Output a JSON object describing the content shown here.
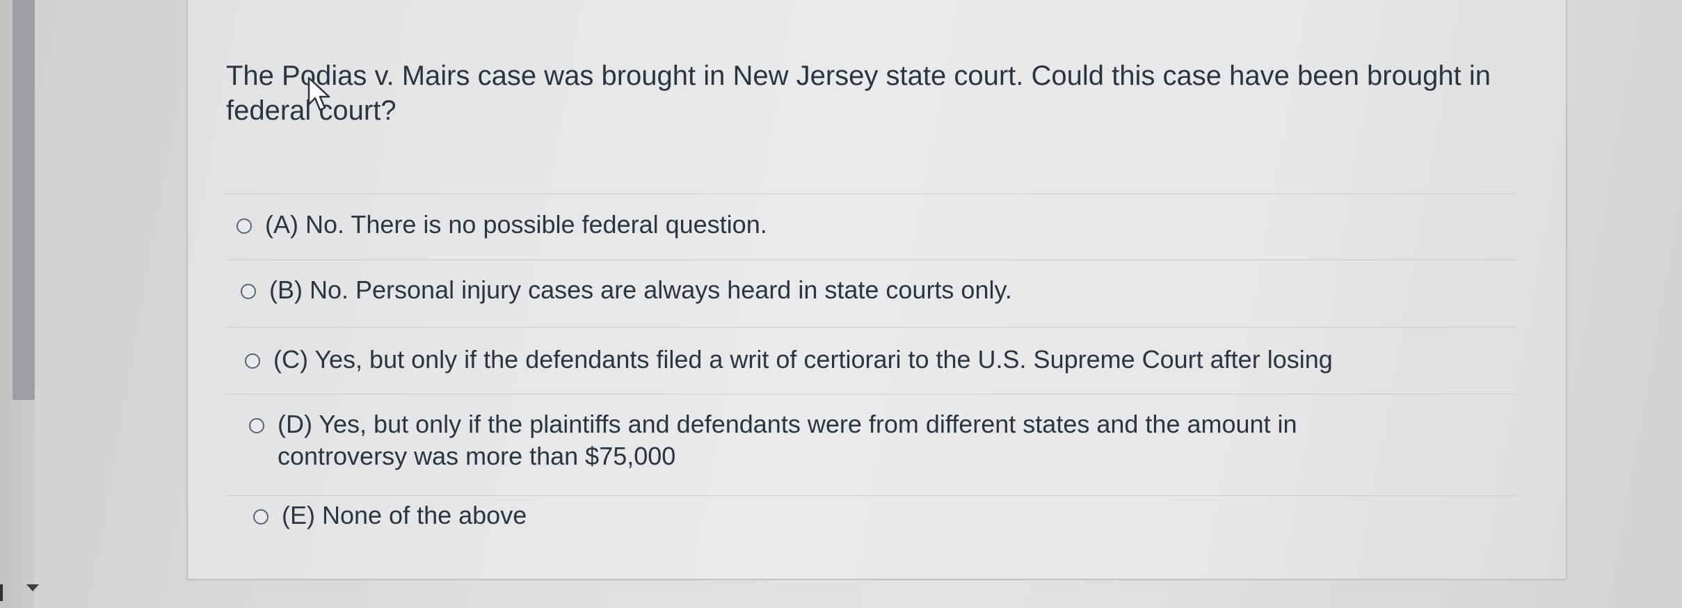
{
  "question": {
    "text": "The Podias v. Mairs case was brought in New Jersey state court.  Could this case have been brought in federal court?"
  },
  "answers": [
    {
      "label": "(A) No. There is no possible federal question."
    },
    {
      "label": "(B) No. Personal injury cases are always heard in state courts only."
    },
    {
      "label": "(C) Yes, but only if the defendants filed a writ of certiorari to the U.S. Supreme Court after losing"
    },
    {
      "label": "(D) Yes, but only if the plaintiffs and defendants were from different states and the amount in controversy was more than $75,000"
    },
    {
      "label": "(E) None of the above"
    }
  ],
  "icons": {
    "radio": "radio-button-icon",
    "cursor": "mouse-pointer-icon",
    "scroll_down": "scroll-down-arrow-icon"
  },
  "colors": {
    "text": "#2d3440",
    "radio_border": "#5b6470",
    "divider": "#c9cbce"
  }
}
